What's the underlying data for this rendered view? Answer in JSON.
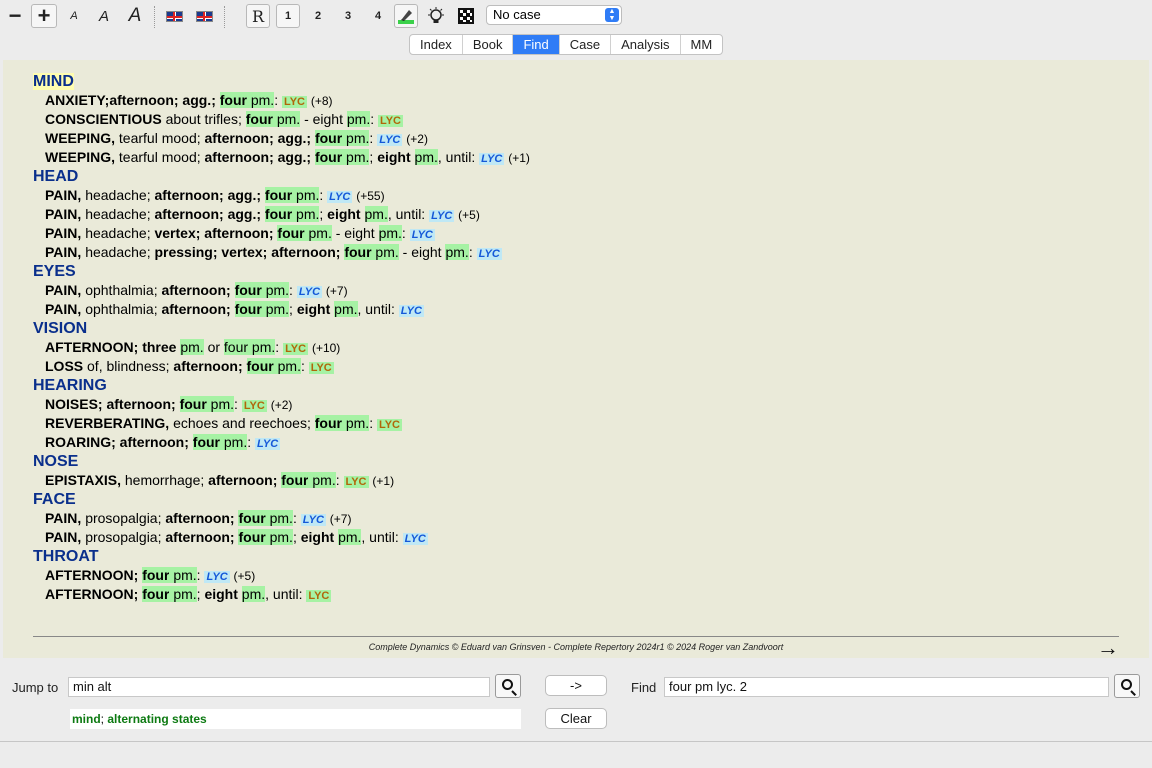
{
  "toolbar": {
    "minus": "−",
    "plus": "+",
    "font_small": "A",
    "font_medium": "A",
    "font_large": "A",
    "btn_r": "R",
    "btn_1": "1",
    "btn_2": "2",
    "btn_3": "3",
    "btn_4": "4",
    "case_select": "No case"
  },
  "tabs": [
    "Index",
    "Book",
    "Find",
    "Case",
    "Analysis",
    "MM"
  ],
  "active_tab": "Find",
  "content": {
    "chapters": [
      {
        "name": "MIND",
        "rubrics": [
          {
            "head": "ANXIETY;",
            "rest": [
              [
                "b",
                "afternoon; agg.; "
              ],
              [
                "hb",
                "four"
              ],
              [
                "h",
                " pm."
              ],
              [
                "t",
                ": "
              ]
            ],
            "rem": "LYC",
            "style": "plain",
            "count": "(+8)"
          },
          {
            "head": "CONSCIENTIOUS",
            "rest": [
              [
                "t",
                " about trifles; "
              ],
              [
                "hb",
                "four"
              ],
              [
                "h",
                " pm."
              ],
              [
                "t",
                " - eight "
              ],
              [
                "h",
                "pm."
              ],
              [
                "t",
                ": "
              ]
            ],
            "rem": "LYC",
            "style": "plain",
            "count": ""
          },
          {
            "head": "WEEPING,",
            "rest": [
              [
                "t",
                " tearful mood; "
              ],
              [
                "b",
                "afternoon; agg.; "
              ],
              [
                "hb",
                "four"
              ],
              [
                "h",
                " pm."
              ],
              [
                "t",
                ": "
              ]
            ],
            "rem": "LYC",
            "style": "ital",
            "count": "(+2)"
          },
          {
            "head": "WEEPING,",
            "rest": [
              [
                "t",
                " tearful mood; "
              ],
              [
                "b",
                "afternoon; agg.; "
              ],
              [
                "hb",
                "four"
              ],
              [
                "h",
                " pm."
              ],
              [
                "t",
                "; "
              ],
              [
                "b",
                "eight "
              ],
              [
                "h",
                "pm."
              ],
              [
                "t",
                ", until: "
              ]
            ],
            "rem": "LYC",
            "style": "ital",
            "count": "(+1)"
          }
        ]
      },
      {
        "name": "HEAD",
        "rubrics": [
          {
            "head": "PAIN,",
            "rest": [
              [
                "t",
                " headache; "
              ],
              [
                "b",
                "afternoon; agg.; "
              ],
              [
                "hb",
                "four"
              ],
              [
                "h",
                " pm."
              ],
              [
                "t",
                ": "
              ]
            ],
            "rem": "LYC",
            "style": "ital",
            "count": "(+55)"
          },
          {
            "head": "PAIN,",
            "rest": [
              [
                "t",
                " headache; "
              ],
              [
                "b",
                "afternoon; agg.; "
              ],
              [
                "hb",
                "four"
              ],
              [
                "h",
                " pm."
              ],
              [
                "t",
                "; "
              ],
              [
                "b",
                "eight "
              ],
              [
                "h",
                "pm."
              ],
              [
                "t",
                ", until: "
              ]
            ],
            "rem": "LYC",
            "style": "ital",
            "count": "(+5)"
          },
          {
            "head": "PAIN,",
            "rest": [
              [
                "t",
                " headache; "
              ],
              [
                "b",
                "vertex; afternoon; "
              ],
              [
                "hb",
                "four"
              ],
              [
                "h",
                " pm."
              ],
              [
                "t",
                " - eight "
              ],
              [
                "h",
                "pm."
              ],
              [
                "t",
                ": "
              ]
            ],
            "rem": "LYC",
            "style": "ital",
            "count": ""
          },
          {
            "head": "PAIN,",
            "rest": [
              [
                "t",
                " headache; "
              ],
              [
                "b",
                "pressing; vertex; afternoon; "
              ],
              [
                "hb",
                "four"
              ],
              [
                "h",
                " pm."
              ],
              [
                "t",
                " - eight "
              ],
              [
                "h",
                "pm."
              ],
              [
                "t",
                ": "
              ]
            ],
            "rem": "LYC",
            "style": "ital",
            "count": ""
          }
        ]
      },
      {
        "name": "EYES",
        "rubrics": [
          {
            "head": "PAIN,",
            "rest": [
              [
                "t",
                " ophthalmia; "
              ],
              [
                "b",
                "afternoon; "
              ],
              [
                "hb",
                "four"
              ],
              [
                "h",
                " pm."
              ],
              [
                "t",
                ": "
              ]
            ],
            "rem": "LYC",
            "style": "ital",
            "count": "(+7)"
          },
          {
            "head": "PAIN,",
            "rest": [
              [
                "t",
                " ophthalmia; "
              ],
              [
                "b",
                "afternoon; "
              ],
              [
                "hb",
                "four"
              ],
              [
                "h",
                " pm."
              ],
              [
                "t",
                "; "
              ],
              [
                "b",
                "eight "
              ],
              [
                "h",
                "pm."
              ],
              [
                "t",
                ", until: "
              ]
            ],
            "rem": "LYC",
            "style": "ital",
            "count": ""
          }
        ]
      },
      {
        "name": "VISION",
        "rubrics": [
          {
            "head": "AFTERNOON;",
            "rest": [
              [
                "b",
                " three "
              ],
              [
                "h",
                "pm."
              ],
              [
                "t",
                " or "
              ],
              [
                "h",
                "four"
              ],
              [
                "h",
                " pm."
              ],
              [
                "t",
                ": "
              ]
            ],
            "rem": "LYC",
            "style": "plain",
            "count": "(+10)"
          },
          {
            "head": "LOSS",
            "rest": [
              [
                "t",
                " of, blindness; "
              ],
              [
                "b",
                "afternoon; "
              ],
              [
                "hb",
                "four"
              ],
              [
                "h",
                " pm."
              ],
              [
                "t",
                ": "
              ]
            ],
            "rem": "LYC",
            "style": "plain",
            "count": ""
          }
        ]
      },
      {
        "name": "HEARING",
        "rubrics": [
          {
            "head": "NOISES;",
            "rest": [
              [
                "b",
                " afternoon; "
              ],
              [
                "hb",
                "four"
              ],
              [
                "h",
                " pm."
              ],
              [
                "t",
                ": "
              ]
            ],
            "rem": "LYC",
            "style": "plain",
            "count": "(+2)"
          },
          {
            "head": "REVERBERATING,",
            "rest": [
              [
                "t",
                " echoes and reechoes; "
              ],
              [
                "hb",
                "four"
              ],
              [
                "h",
                " pm."
              ],
              [
                "t",
                ": "
              ]
            ],
            "rem": "LYC",
            "style": "plain",
            "count": ""
          },
          {
            "head": "ROARING;",
            "rest": [
              [
                "b",
                " afternoon; "
              ],
              [
                "hb",
                "four"
              ],
              [
                "h",
                " pm."
              ],
              [
                "t",
                ": "
              ]
            ],
            "rem": "LYC",
            "style": "ital",
            "count": ""
          }
        ]
      },
      {
        "name": "NOSE",
        "rubrics": [
          {
            "head": "EPISTAXIS,",
            "rest": [
              [
                "t",
                " hemorrhage; "
              ],
              [
                "b",
                "afternoon; "
              ],
              [
                "hb",
                "four"
              ],
              [
                "h",
                " pm."
              ],
              [
                "t",
                ": "
              ]
            ],
            "rem": "LYC",
            "style": "plain",
            "count": "(+1)"
          }
        ]
      },
      {
        "name": "FACE",
        "rubrics": [
          {
            "head": "PAIN,",
            "rest": [
              [
                "t",
                " prosopalgia; "
              ],
              [
                "b",
                "afternoon; "
              ],
              [
                "hb",
                "four"
              ],
              [
                "h",
                " pm."
              ],
              [
                "t",
                ": "
              ]
            ],
            "rem": "LYC",
            "style": "ital",
            "count": "(+7)"
          },
          {
            "head": "PAIN,",
            "rest": [
              [
                "t",
                " prosopalgia; "
              ],
              [
                "b",
                "afternoon; "
              ],
              [
                "hb",
                "four"
              ],
              [
                "h",
                " pm."
              ],
              [
                "t",
                "; "
              ],
              [
                "b",
                "eight "
              ],
              [
                "h",
                "pm."
              ],
              [
                "t",
                ", until: "
              ]
            ],
            "rem": "LYC",
            "style": "ital",
            "count": ""
          }
        ]
      },
      {
        "name": "THROAT",
        "rubrics": [
          {
            "head": "AFTERNOON;",
            "rest": [
              [
                "b",
                " "
              ],
              [
                "hb",
                "four"
              ],
              [
                "h",
                " pm."
              ],
              [
                "t",
                ": "
              ]
            ],
            "rem": "LYC",
            "style": "ital",
            "count": "(+5)"
          },
          {
            "head": "AFTERNOON;",
            "rest": [
              [
                "b",
                " "
              ],
              [
                "hb",
                "four"
              ],
              [
                "h",
                " pm."
              ],
              [
                "t",
                "; "
              ],
              [
                "b",
                "eight "
              ],
              [
                "h",
                "pm."
              ],
              [
                "t",
                ", until: "
              ]
            ],
            "rem": "LYC",
            "style": "plain",
            "count": ""
          }
        ]
      }
    ]
  },
  "footer": {
    "credit": "Complete Dynamics © Eduard van Grinsven   -   Complete Repertory 2024r1 © 2024 Roger van Zandvoort",
    "next_arrow": "→"
  },
  "bottom": {
    "jump_label": "Jump to",
    "jump_value": "min alt",
    "arrow_button": "->",
    "clear_button": "Clear",
    "find_label": "Find",
    "find_value": "four pm lyc. 2",
    "suggestion_chapter": "mind",
    "suggestion_sep": "; ",
    "suggestion_rubric": "alternating states"
  },
  "colors": {
    "accent": "#2f7cf6",
    "chapter": "#0a2f8c",
    "highlight": "#a6f2a4",
    "panel": "#eaead9",
    "suggestion": "#0d7a12"
  }
}
